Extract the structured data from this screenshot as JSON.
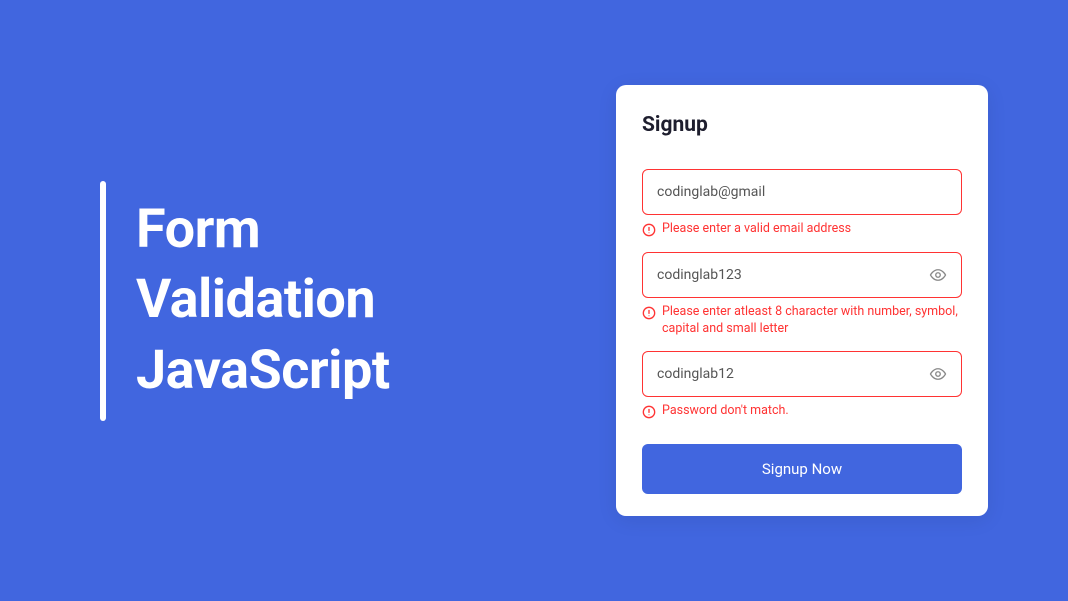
{
  "hero": {
    "line1": "Form",
    "line2": "Validation",
    "line3": "JavaScript"
  },
  "form": {
    "title": "Signup",
    "email": {
      "value": "codinglab@gmail",
      "error": "Please enter a valid email address"
    },
    "password": {
      "value": "codinglab123",
      "error": "Please enter atleast 8 character with number, symbol, capital and small letter"
    },
    "confirm": {
      "value": "codinglab12",
      "error": "Password don't match."
    },
    "submit_label": "Signup Now"
  }
}
